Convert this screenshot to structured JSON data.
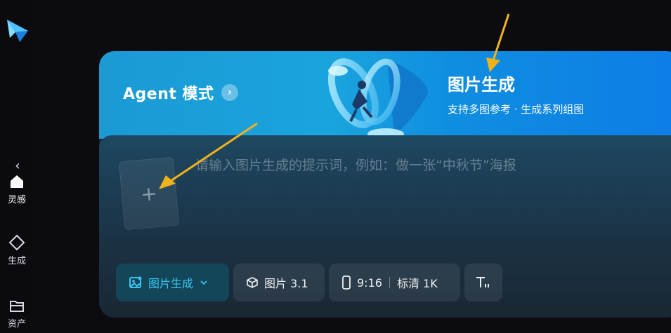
{
  "sidebar": {
    "items": [
      {
        "label": "灵感",
        "icon": "home-icon"
      },
      {
        "label": "生成",
        "icon": "diamond-icon"
      },
      {
        "label": "资产",
        "icon": "folder-icon"
      }
    ],
    "collapse_icon": "chevron-left-icon",
    "logo_icon": "app-logo-icon"
  },
  "banner": {
    "title": "Agent 模式",
    "chevron": "›",
    "feature_title": "图片生成",
    "feature_subtitle": "支持多图参考 · 生成系列组图"
  },
  "input": {
    "upload_plus": "+",
    "placeholder": "请输入图片生成的提示词，例如：做一张“中秋节”海报"
  },
  "toolbar": {
    "mode_label": "图片生成",
    "model_label": "图片 3.1",
    "ratio_label": "9:16",
    "quality_label": "标清 1K",
    "text_icon": "text-style-icon"
  },
  "colors": {
    "accent": "#37c6f0",
    "annotation_arrow": "#f2b21a"
  }
}
